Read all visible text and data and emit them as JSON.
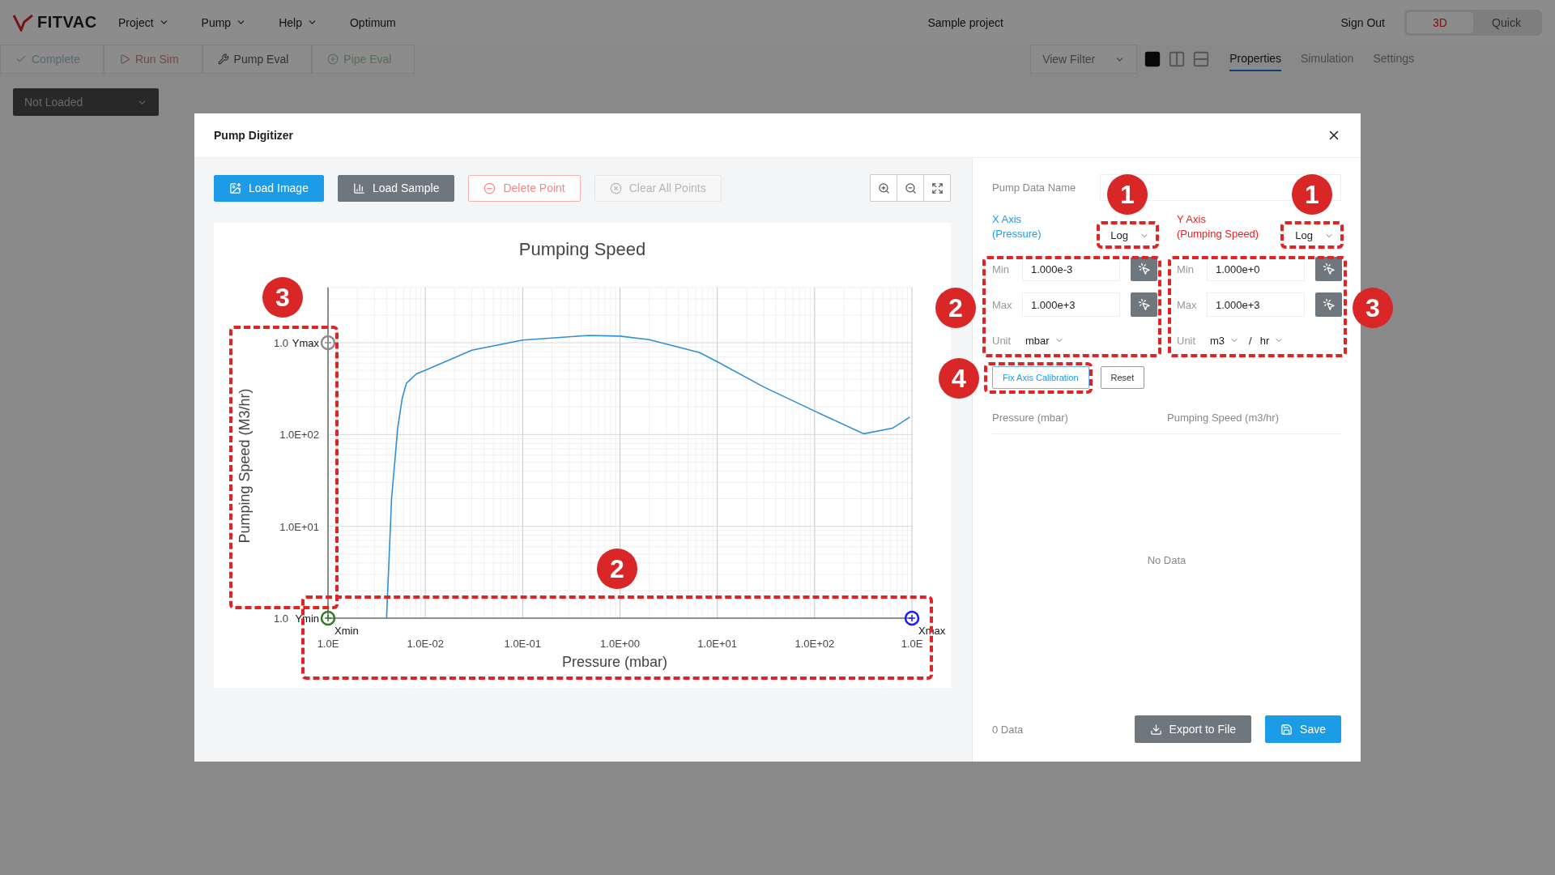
{
  "app_header": {
    "logo": "FITVAC",
    "menus": [
      {
        "label": "Project",
        "kind": "dropdown"
      },
      {
        "label": "Pump",
        "kind": "dropdown"
      },
      {
        "label": "Help",
        "kind": "dropdown"
      },
      {
        "label": "Optimum",
        "kind": "link"
      }
    ],
    "project_title": "Sample project",
    "sign_out": "Sign Out",
    "view_modes": [
      {
        "label": "3D",
        "selected": true
      },
      {
        "label": "Quick",
        "selected": false
      }
    ]
  },
  "toolbar": {
    "actions": [
      {
        "label": "Complete"
      },
      {
        "label": "Run Sim"
      },
      {
        "label": "Pump Eval"
      },
      {
        "label": "Pipe Eval"
      }
    ],
    "view_filter": "View Filter",
    "layouts": [
      {
        "selected": true
      },
      {
        "selected": false
      },
      {
        "selected": false
      }
    ]
  },
  "side_tabs": [
    {
      "label": "Properties",
      "selected": true
    },
    {
      "label": "Simulation",
      "selected": false
    },
    {
      "label": "Settings",
      "selected": false
    }
  ],
  "model_select": "Not Loaded",
  "dialog": {
    "title": "Pump Digitizer",
    "toolbar": [
      {
        "label": "Load Image",
        "kind": "primary"
      },
      {
        "label": "Load Sample",
        "kind": "secondary"
      },
      {
        "label": "Delete Point",
        "kind": "danger"
      },
      {
        "label": "Clear All Points",
        "kind": "muted"
      }
    ],
    "chart": {
      "title": "Pumping Speed",
      "xlabel": "Pressure (mbar)",
      "ylabel": "Pumping Speed (M3/hr)",
      "x_tick_labels": [
        "1.0E",
        "1.0E-02",
        "1.0E-01",
        "1.0E+00",
        "1.0E+01",
        "1.0E+02",
        "1.0E"
      ],
      "y_tick_labels": [
        "1.0",
        "1.0E+02",
        "1.0E+01",
        "1.0"
      ],
      "calibration_markers": [
        {
          "labels": [
            "Ymax"
          ],
          "color": "#8c8c8c"
        },
        {
          "labels": [
            "Ymin",
            "Xmin"
          ],
          "color": "#2e7d1e"
        },
        {
          "labels": [
            "Xmax"
          ],
          "color": "#1a1aff"
        }
      ]
    },
    "settings": {
      "name_label": "Pump Data Name",
      "axes": [
        {
          "title": "X Axis",
          "subtitle": "(Pressure)",
          "color": "#1c9be6",
          "scale": "Log",
          "min_label": "Min",
          "min": "1.000e-3",
          "max_label": "Max",
          "max": "1.000e+3",
          "unit_label": "Unit",
          "units": [
            "mbar"
          ]
        },
        {
          "title": "Y Axis",
          "subtitle": "(Pumping Speed)",
          "color": "#e02424",
          "scale": "Log",
          "min_label": "Min",
          "min": "1.000e+0",
          "max_label": "Max",
          "max": "1.000e+3",
          "unit_label": "Unit",
          "units": [
            "m3",
            "hr"
          ],
          "unit_separator": "/"
        }
      ],
      "calibration_buttons": [
        {
          "label": "Fix Axis Calibration",
          "kind": "outline-primary"
        },
        {
          "label": "Reset",
          "kind": "outline"
        }
      ],
      "table": {
        "columns": [
          "Pressure (mbar)",
          "Pumping Speed (m3/hr)"
        ],
        "empty_text": "No Data"
      },
      "footer": {
        "count": "0 Data",
        "buttons": [
          {
            "label": "Export to File",
            "kind": "secondary"
          },
          {
            "label": "Save",
            "kind": "primary"
          }
        ]
      }
    }
  },
  "callouts": [
    {
      "number": "1"
    },
    {
      "number": "1"
    },
    {
      "number": "2"
    },
    {
      "number": "3"
    },
    {
      "number": "4"
    },
    {
      "number": "3"
    },
    {
      "number": "2"
    }
  ]
}
